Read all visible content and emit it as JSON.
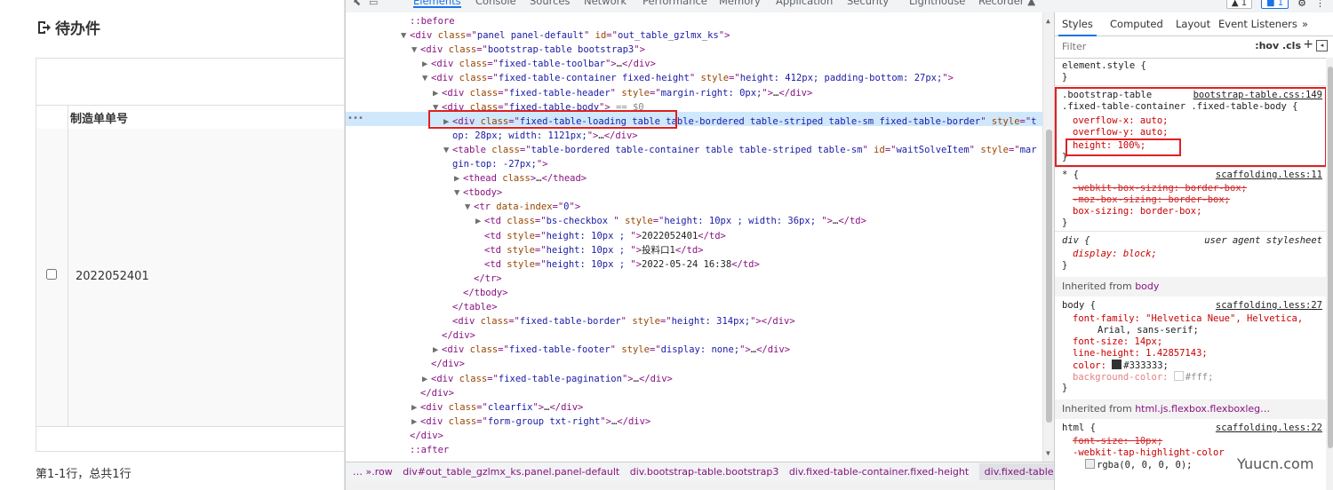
{
  "page": {
    "title": "待办件",
    "column_order": "制造单单号",
    "row_value": "2022052401",
    "pagination": "第1-1行，总共1行"
  },
  "devtools": {
    "tabs": [
      "Elements",
      "Console",
      "Sources",
      "Network",
      "Performance",
      "Memory",
      "Application",
      "Security",
      "Lighthouse",
      "Recorder ▲"
    ],
    "badges": [
      "▲ 1",
      "■ 1",
      "⚙",
      "⋮"
    ],
    "tree": [
      {
        "indent": 0,
        "html": "<span class=\"pseudo\">::before</span>"
      },
      {
        "indent": 0,
        "tri": "▼",
        "html": "<span class=\"tag\">&lt;div </span><span class=\"attr\">class</span><span class=\"tag\">=\"</span><span class=\"val\">panel panel-default</span><span class=\"tag\">\" </span><span class=\"attr\">id</span><span class=\"tag\">=\"</span><span class=\"val\">out_table_gzlmx_ks</span><span class=\"tag\">\"&gt;</span>"
      },
      {
        "indent": 1,
        "tri": "▼",
        "html": "<span class=\"tag\">&lt;div </span><span class=\"attr\">class</span><span class=\"tag\">=\"</span><span class=\"val\">bootstrap-table bootstrap3</span><span class=\"tag\">\"&gt;</span>"
      },
      {
        "indent": 2,
        "tri": "▶",
        "html": "<span class=\"tag\">&lt;div </span><span class=\"attr\">class</span><span class=\"tag\">=\"</span><span class=\"val\">fixed-table-toolbar</span><span class=\"tag\">\"&gt;</span><span class=\"txt\">…</span><span class=\"tag\">&lt;/div&gt;</span>"
      },
      {
        "indent": 2,
        "tri": "▼",
        "html": "<span class=\"tag\">&lt;div </span><span class=\"attr\">class</span><span class=\"tag\">=\"</span><span class=\"val\">fixed-table-container fixed-height</span><span class=\"tag\">\" </span><span class=\"attr\">style</span><span class=\"tag\">=\"</span><span class=\"val\">height: 412px; padding-bottom: 27px;</span><span class=\"tag\">\"&gt;</span>"
      },
      {
        "indent": 3,
        "tri": "▶",
        "html": "<span class=\"tag\">&lt;div </span><span class=\"attr\">class</span><span class=\"tag\">=\"</span><span class=\"val\">fixed-table-header</span><span class=\"tag\">\" </span><span class=\"attr\">style</span><span class=\"tag\">=\"</span><span class=\"val\">margin-right: 0px;</span><span class=\"tag\">\"&gt;</span><span class=\"txt\">…</span><span class=\"tag\">&lt;/div&gt;</span>"
      },
      {
        "indent": 3,
        "tri": "▼",
        "html": "<span class=\"tag\">&lt;div </span><span class=\"attr\">class</span><span class=\"tag\">=\"</span><span class=\"val\">fixed-table-body</span><span class=\"tag\">\"&gt;</span><span class=\"sel-marker\"> == $0</span>"
      },
      {
        "indent": 4,
        "tri": "▶",
        "html": "<span class=\"tag\">&lt;div </span><span class=\"attr\">class</span><span class=\"tag\">=\"</span><span class=\"val\">fixed-table-loading table table-bordered table-striped table-sm fixed-table-border</span><span class=\"tag\">\" </span><span class=\"attr\">style</span><span class=\"tag\">=\"</span><span class=\"val\">t</span>"
      },
      {
        "indent": 4,
        "cont": true,
        "html": "<span class=\"val\">op: 28px; width: 1121px;</span><span class=\"tag\">\"&gt;</span><span class=\"txt\">…</span><span class=\"tag\">&lt;/div&gt;</span>"
      },
      {
        "indent": 4,
        "tri": "▼",
        "html": "<span class=\"tag\">&lt;table </span><span class=\"attr\">class</span><span class=\"tag\">=\"</span><span class=\"val\">table-bordered table-container table table-striped table-sm</span><span class=\"tag\">\" </span><span class=\"attr\">id</span><span class=\"tag\">=\"</span><span class=\"val\">waitSolveItem</span><span class=\"tag\">\" </span><span class=\"attr\">style</span><span class=\"tag\">=\"</span><span class=\"val\">mar</span>"
      },
      {
        "indent": 4,
        "cont": true,
        "html": "<span class=\"val\">gin-top: -27px;</span><span class=\"tag\">\"&gt;</span>"
      },
      {
        "indent": 5,
        "tri": "▶",
        "html": "<span class=\"tag\">&lt;thead </span><span class=\"attr\">class</span><span class=\"tag\">&gt;</span><span class=\"txt\">…</span><span class=\"tag\">&lt;/thead&gt;</span>"
      },
      {
        "indent": 5,
        "tri": "▼",
        "html": "<span class=\"tag\">&lt;tbody&gt;</span>"
      },
      {
        "indent": 6,
        "tri": "▼",
        "html": "<span class=\"tag\">&lt;tr </span><span class=\"attr\">data-index</span><span class=\"tag\">=\"</span><span class=\"val\">0</span><span class=\"tag\">\"&gt;</span>"
      },
      {
        "indent": 7,
        "tri": "▶",
        "html": "<span class=\"tag\">&lt;td </span><span class=\"attr\">class</span><span class=\"tag\">=\"</span><span class=\"val\">bs-checkbox </span><span class=\"tag\">\" </span><span class=\"attr\">style</span><span class=\"tag\">=\"</span><span class=\"val\">height: 10px ; width: 36px; </span><span class=\"tag\">\"&gt;</span><span class=\"txt\">…</span><span class=\"tag\">&lt;/td&gt;</span>"
      },
      {
        "indent": 7,
        "html": "<span class=\"tag\">&lt;td </span><span class=\"attr\">style</span><span class=\"tag\">=\"</span><span class=\"val\">height: 10px ; </span><span class=\"tag\">\"&gt;</span><span class=\"txt\">2022052401</span><span class=\"tag\">&lt;/td&gt;</span>"
      },
      {
        "indent": 7,
        "html": "<span class=\"tag\">&lt;td </span><span class=\"attr\">style</span><span class=\"tag\">=\"</span><span class=\"val\">height: 10px ; </span><span class=\"tag\">\"&gt;</span><span class=\"txt\">投料口1</span><span class=\"tag\">&lt;/td&gt;</span>"
      },
      {
        "indent": 7,
        "html": "<span class=\"tag\">&lt;td </span><span class=\"attr\">style</span><span class=\"tag\">=\"</span><span class=\"val\">height: 10px ; </span><span class=\"tag\">\"&gt;</span><span class=\"txt\">2022-05-24 16:38</span><span class=\"tag\">&lt;/td&gt;</span>"
      },
      {
        "indent": 6,
        "html": "<span class=\"tag\">&lt;/tr&gt;</span>"
      },
      {
        "indent": 5,
        "html": "<span class=\"tag\">&lt;/tbody&gt;</span>"
      },
      {
        "indent": 4,
        "html": "<span class=\"tag\">&lt;/table&gt;</span>"
      },
      {
        "indent": 4,
        "html": "<span class=\"tag\">&lt;div </span><span class=\"attr\">class</span><span class=\"tag\">=\"</span><span class=\"val\">fixed-table-border</span><span class=\"tag\">\" </span><span class=\"attr\">style</span><span class=\"tag\">=\"</span><span class=\"val\">height: 314px;</span><span class=\"tag\">\"&gt;&lt;/div&gt;</span>"
      },
      {
        "indent": 3,
        "html": "<span class=\"tag\">&lt;/div&gt;</span>"
      },
      {
        "indent": 3,
        "tri": "▶",
        "html": "<span class=\"tag\">&lt;div </span><span class=\"attr\">class</span><span class=\"tag\">=\"</span><span class=\"val\">fixed-table-footer</span><span class=\"tag\">\" </span><span class=\"attr\">style</span><span class=\"tag\">=\"</span><span class=\"val\">display: none;</span><span class=\"tag\">\"&gt;</span><span class=\"txt\">…</span><span class=\"tag\">&lt;/div&gt;</span>"
      },
      {
        "indent": 2,
        "html": "<span class=\"tag\">&lt;/div&gt;</span>"
      },
      {
        "indent": 2,
        "tri": "▶",
        "html": "<span class=\"tag\">&lt;div </span><span class=\"attr\">class</span><span class=\"tag\">=\"</span><span class=\"val\">fixed-table-pagination</span><span class=\"tag\">\"&gt;</span><span class=\"txt\">…</span><span class=\"tag\">&lt;/div&gt;</span>"
      },
      {
        "indent": 1,
        "html": "<span class=\"tag\">&lt;/div&gt;</span>"
      },
      {
        "indent": 1,
        "tri": "▶",
        "html": "<span class=\"tag\">&lt;div </span><span class=\"attr\">class</span><span class=\"tag\">=\"</span><span class=\"val\">clearfix</span><span class=\"tag\">\"&gt;</span><span class=\"txt\">…</span><span class=\"tag\">&lt;/div&gt;</span>"
      },
      {
        "indent": 1,
        "tri": "▶",
        "html": "<span class=\"tag\">&lt;div </span><span class=\"attr\">class</span><span class=\"tag\">=\"</span><span class=\"val\">form-group txt-right</span><span class=\"tag\">\"&gt;</span><span class=\"txt\">…</span><span class=\"tag\">&lt;/div&gt;</span>"
      },
      {
        "indent": 0,
        "html": "<span class=\"tag\">&lt;/div&gt;</span>"
      },
      {
        "indent": 0,
        "html": "<span class=\"pseudo\">::after</span>"
      }
    ],
    "breadcrumb": [
      "… ».row",
      "div#out_table_gzlmx_ks.panel.panel-default",
      "div.bootstrap-table.bootstrap3",
      "div.fixed-table-container.fixed-height",
      "div.fixed-table-body",
      "…"
    ],
    "styles_tabs": [
      "Styles",
      "Computed",
      "Layout",
      "Event Listeners",
      "»"
    ],
    "filter_placeholder": "Filter",
    "filter_tools": ":hov .cls",
    "element_style": "element.style {",
    "rules": {
      "r1_sel1": ".bootstrap-table",
      "r1_src": "bootstrap-table.css:149",
      "r1_sel2": ".fixed-table-container .fixed-table-body {",
      "r1_p1": "overflow-x: auto;",
      "r1_p2": "overflow-y: auto;",
      "r1_p3": "height: 100%;",
      "r2_sel": "* {",
      "r2_src": "scaffolding.less:11",
      "r2_p1": "-webkit-box-sizing: border-box;",
      "r2_p2": "-moz-box-sizing: border-box;",
      "r2_p3": "box-sizing: border-box;",
      "r3_sel": "div {",
      "r3_src": "user agent stylesheet",
      "r3_p1": "display: block;",
      "inh1_label": "Inherited from",
      "inh1_link": "body",
      "r4_sel": "body {",
      "r4_src": "scaffolding.less:27",
      "r4_p1": "font-family: \"Helvetica Neue\", Helvetica,",
      "r4_p1b": "Arial, sans-serif;",
      "r4_p2": "font-size: 14px;",
      "r4_p3": "line-height: 1.42857143;",
      "r4_p4_label": "color:",
      "r4_p4_val": "#333333;",
      "r4_p5_label": "background-color:",
      "r4_p5_val": "#fff;",
      "inh2_label": "Inherited from",
      "inh2_link": "html.js.flexbox.flexboxleg…",
      "r5_sel": "html {",
      "r5_src": "scaffolding.less:22",
      "r5_p1": "font-size: 10px;",
      "r5_p2": "-webkit-tap-highlight-color",
      "r5_p3": "rgba(0, 0, 0, 0);",
      "close": "}"
    },
    "colors": {
      "selected_row": "#cfe8fc",
      "highlight_box": "#e02020",
      "accent": "#1a73e8"
    }
  },
  "watermark": "Yuucn.com"
}
